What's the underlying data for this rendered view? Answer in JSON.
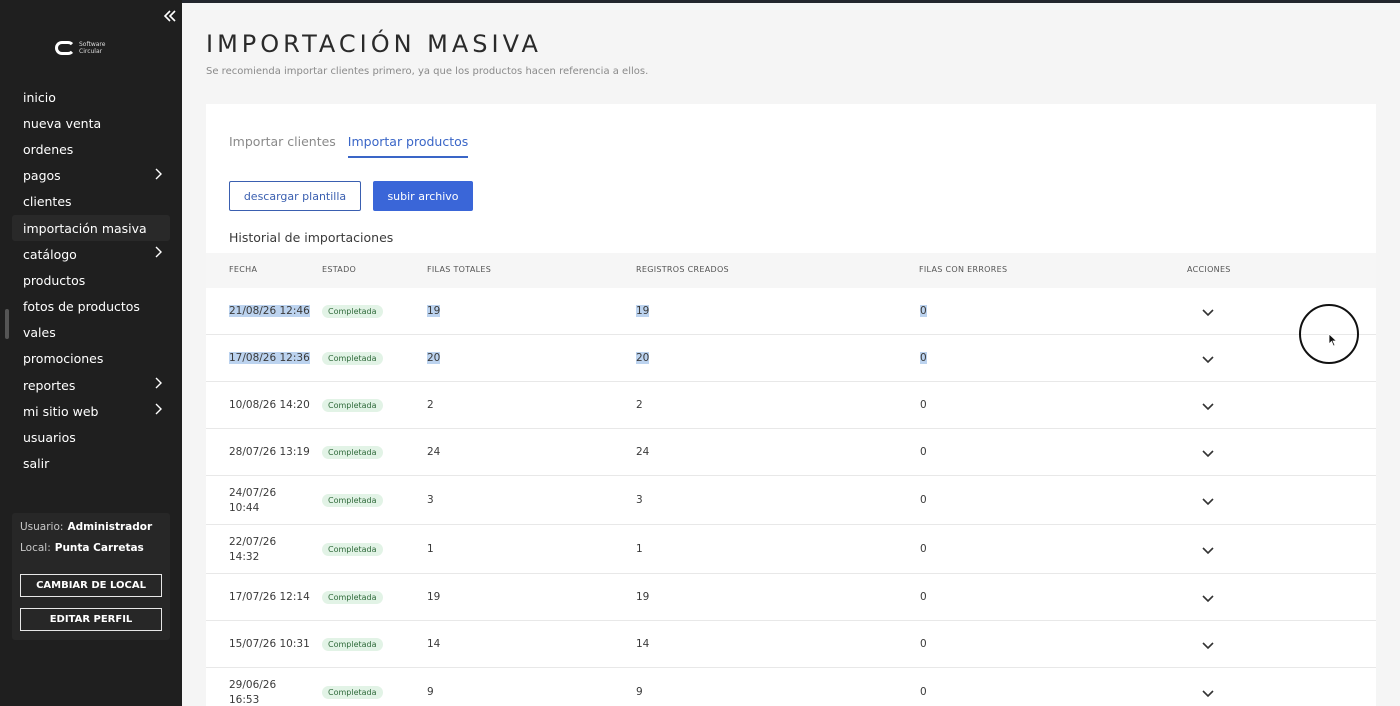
{
  "sidebar": {
    "logo_line1": "Software",
    "logo_line2": "Circular",
    "items": [
      {
        "label": "inicio",
        "has_submenu": false,
        "active": false
      },
      {
        "label": "nueva venta",
        "has_submenu": false,
        "active": false
      },
      {
        "label": "ordenes",
        "has_submenu": false,
        "active": false
      },
      {
        "label": "pagos",
        "has_submenu": true,
        "active": false
      },
      {
        "label": "clientes",
        "has_submenu": false,
        "active": false
      },
      {
        "label": "importación masiva",
        "has_submenu": false,
        "active": true
      },
      {
        "label": "catálogo",
        "has_submenu": true,
        "active": false
      },
      {
        "label": "productos",
        "has_submenu": false,
        "active": false
      },
      {
        "label": "fotos de productos",
        "has_submenu": false,
        "active": false
      },
      {
        "label": "vales",
        "has_submenu": false,
        "active": false
      },
      {
        "label": "promociones",
        "has_submenu": false,
        "active": false
      },
      {
        "label": "reportes",
        "has_submenu": true,
        "active": false
      },
      {
        "label": "mi sitio web",
        "has_submenu": true,
        "active": false
      },
      {
        "label": "usuarios",
        "has_submenu": false,
        "active": false
      },
      {
        "label": "salir",
        "has_submenu": false,
        "active": false
      }
    ],
    "user_label": "Usuario:",
    "user_value": "Administrador",
    "local_label": "Local:",
    "local_value": "Punta Carretas",
    "change_local_button": "CAMBIAR DE LOCAL",
    "edit_profile_button": "EDITAR PERFIL"
  },
  "header": {
    "title": "IMPORTACIÓN MASIVA",
    "subtitle": "Se recomienda importar clientes primero, ya que los productos hacen referencia a ellos."
  },
  "tabs": [
    {
      "label": "Importar clientes",
      "active": false
    },
    {
      "label": "Importar productos",
      "active": true
    }
  ],
  "actions": {
    "download_template": "descargar plantilla",
    "upload_file": "subir archivo"
  },
  "history": {
    "title": "Historial de importaciones",
    "columns": [
      "FECHA",
      "ESTADO",
      "FILAS TOTALES",
      "REGISTROS CREADOS",
      "FILAS CON ERRORES",
      "ACCIONES"
    ],
    "rows": [
      {
        "fecha": "21/08/26 12:46",
        "estado": "Completada",
        "filas_totales": "19",
        "registros_creados": "19",
        "filas_con_errores": "0",
        "selected": true
      },
      {
        "fecha": "17/08/26 12:36",
        "estado": "Completada",
        "filas_totales": "20",
        "registros_creados": "20",
        "filas_con_errores": "0",
        "selected": true
      },
      {
        "fecha": "10/08/26 14:20",
        "estado": "Completada",
        "filas_totales": "2",
        "registros_creados": "2",
        "filas_con_errores": "0",
        "selected": false
      },
      {
        "fecha": "28/07/26 13:19",
        "estado": "Completada",
        "filas_totales": "24",
        "registros_creados": "24",
        "filas_con_errores": "0",
        "selected": false
      },
      {
        "fecha": "24/07/26 10:44",
        "estado": "Completada",
        "filas_totales": "3",
        "registros_creados": "3",
        "filas_con_errores": "0",
        "selected": false
      },
      {
        "fecha": "22/07/26 14:32",
        "estado": "Completada",
        "filas_totales": "1",
        "registros_creados": "1",
        "filas_con_errores": "0",
        "selected": false
      },
      {
        "fecha": "17/07/26 12:14",
        "estado": "Completada",
        "filas_totales": "19",
        "registros_creados": "19",
        "filas_con_errores": "0",
        "selected": false
      },
      {
        "fecha": "15/07/26 10:31",
        "estado": "Completada",
        "filas_totales": "14",
        "registros_creados": "14",
        "filas_con_errores": "0",
        "selected": false
      },
      {
        "fecha": "29/06/26 16:53",
        "estado": "Completada",
        "filas_totales": "9",
        "registros_creados": "9",
        "filas_con_errores": "0",
        "selected": false
      }
    ]
  },
  "colors": {
    "accent": "#3a66d8",
    "sidebar_bg": "#1f1f1f",
    "badge_bg": "#e2f3e6",
    "badge_text": "#2f6a3a",
    "selection": "#bcd3ef"
  },
  "icons": {
    "collapse": "double-chevron-left-icon",
    "submenu": "chevron-right-icon",
    "row_action": "chevron-down-icon"
  }
}
